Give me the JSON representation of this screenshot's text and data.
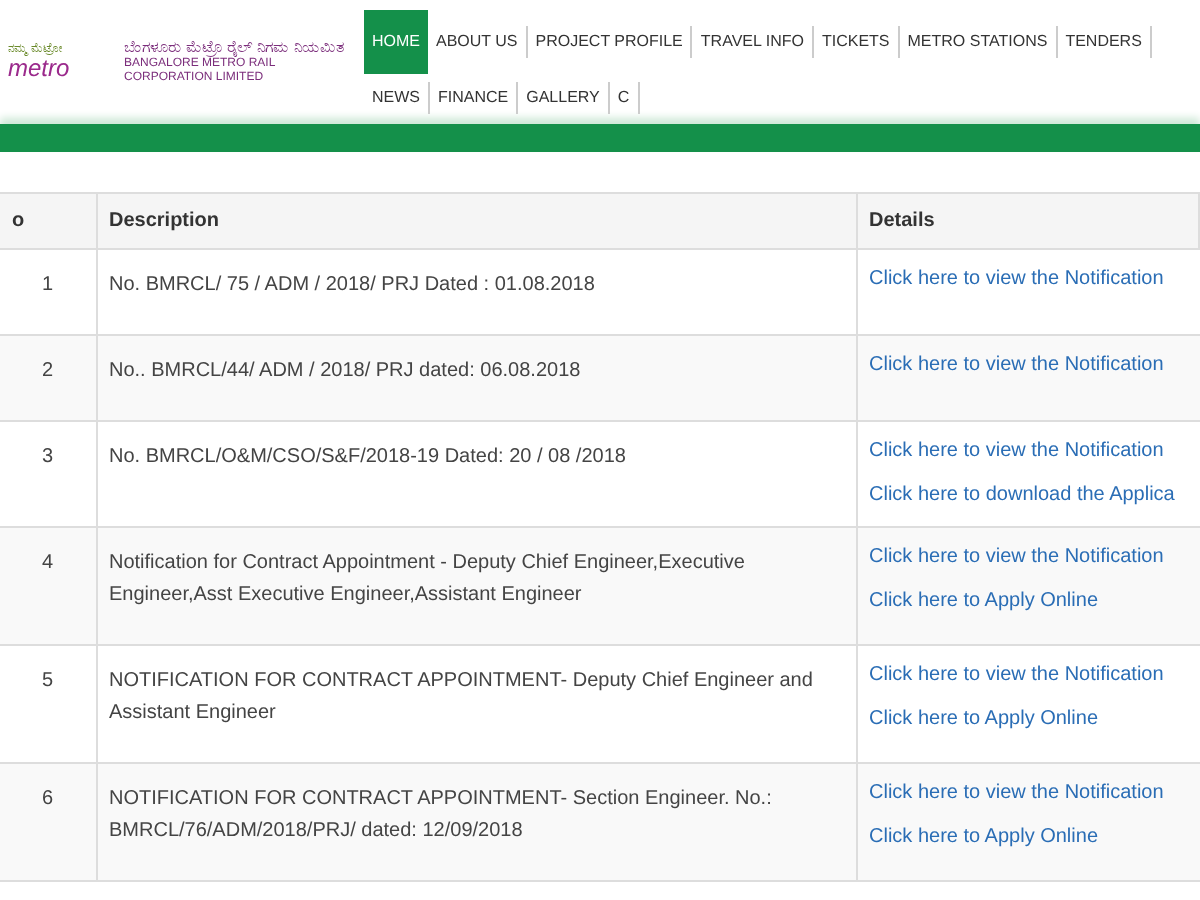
{
  "header": {
    "logo": {
      "kannada_small": "ನಮ್ಮ ಮೆಟ್ರೋ",
      "word": "metro"
    },
    "org_name_kannada": "ಬೆಂಗಳೂರು ಮೆಟ್ರೊ ರೈಲ್ ನಿಗಮ ನಿಯಮಿತ",
    "org_name": "BANGALORE METRO RAIL CORPORATION LIMITED"
  },
  "nav": [
    {
      "label": "HOME",
      "selected": true
    },
    {
      "label": "ABOUT US",
      "selected": false
    },
    {
      "label": "PROJECT PROFILE",
      "selected": false
    },
    {
      "label": "TRAVEL INFO",
      "selected": false
    },
    {
      "label": "TICKETS",
      "selected": false
    },
    {
      "label": "METRO STATIONS",
      "selected": false
    },
    {
      "label": "TENDERS",
      "selected": false
    },
    {
      "label": "NEWS",
      "selected": false
    },
    {
      "label": "FINANCE",
      "selected": false
    },
    {
      "label": "GALLERY",
      "selected": false
    },
    {
      "label": "C",
      "selected": false
    }
  ],
  "table": {
    "columns": [
      "o",
      "Description",
      "Details"
    ],
    "rows": [
      {
        "no": "1",
        "description": "No. BMRCL/ 75 / ADM / 2018/ PRJ Dated : 01.08.2018",
        "links": [
          "Click here to view the Notification"
        ]
      },
      {
        "no": "2",
        "description": "No.. BMRCL/44/ ADM / 2018/ PRJ dated: 06.08.2018",
        "links": [
          "Click here to view the Notification"
        ]
      },
      {
        "no": "3",
        "description": "No. BMRCL/O&M/CSO/S&F/2018-19 Dated: 20 / 08 /2018",
        "links": [
          "Click here to view the Notification",
          "Click here to download the Applica"
        ]
      },
      {
        "no": "4",
        "description": "Notification for Contract Appointment - Deputy Chief Engineer,Executive Engineer,Asst Executive Engineer,Assistant Engineer",
        "links": [
          "Click here to view the Notification",
          "Click here to Apply Online"
        ]
      },
      {
        "no": "5",
        "description": "NOTIFICATION FOR CONTRACT APPOINTMENT- Deputy Chief Engineer and Assistant Engineer",
        "links": [
          "Click here to view the Notification",
          "Click here to Apply Online"
        ]
      },
      {
        "no": "6",
        "description": "NOTIFICATION FOR CONTRACT APPOINTMENT- Section Engineer. No.: BMRCL/76/ADM/2018/PRJ/ dated: 12/09/2018",
        "links": [
          "Click here to view the Notification",
          "Click here to Apply Online"
        ]
      }
    ]
  }
}
